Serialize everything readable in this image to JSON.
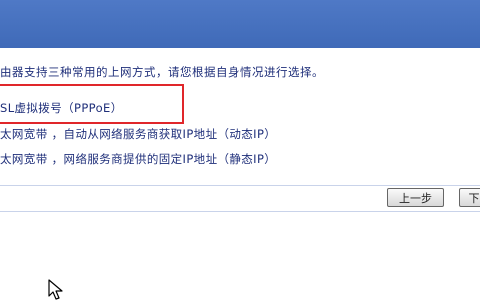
{
  "intro_text": "由器支持三种常用的上网方式，请您根据自身情况进行选择。",
  "options": [
    {
      "label": "SL虚拟拨号（PPPoE）"
    },
    {
      "label": "太网宽带 ，自动从网络服务商获取IP地址（动态IP）"
    },
    {
      "label": "太网宽带 ，网络服务商提供的固定IP地址（静态IP）"
    }
  ],
  "buttons": {
    "prev": "上一步",
    "next": "下"
  },
  "colors": {
    "header": "#4a74c2",
    "text": "#1f2f7a",
    "highlight": "#e0262a"
  },
  "icons": [
    "mouse-cursor-icon"
  ]
}
